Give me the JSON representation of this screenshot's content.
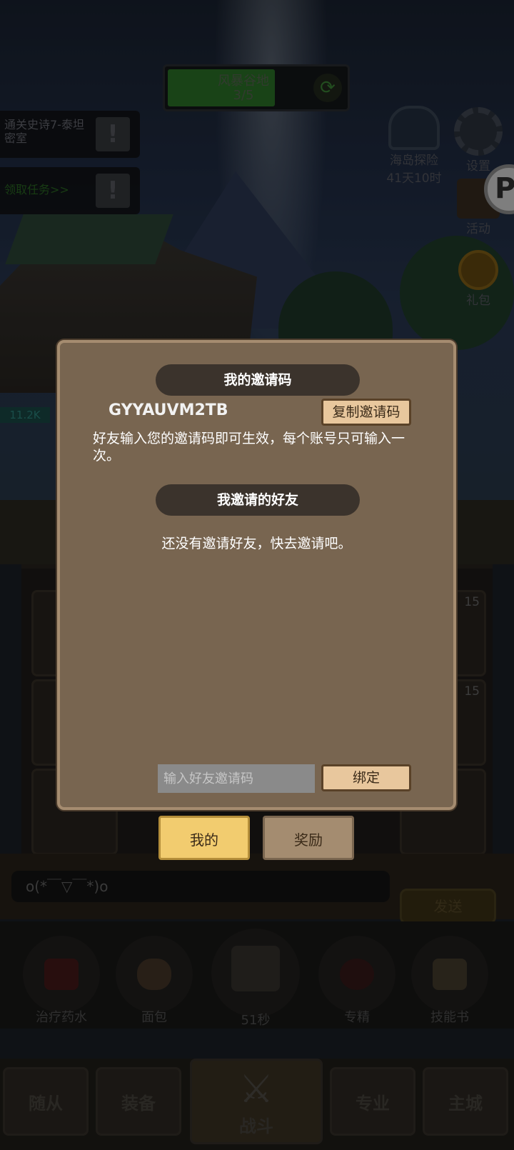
{
  "hud": {
    "storm": {
      "title": "风暴谷地",
      "progress_text": "3/5",
      "progress": 0.6
    },
    "quests": [
      {
        "text": "通关史诗7-泰坦密室"
      },
      {
        "text": "领取任务>>"
      }
    ],
    "island": {
      "label": "海岛探险",
      "timer": "41天10时"
    },
    "settings_label": "设置",
    "activity_label": "活动",
    "gift_label": "礼包"
  },
  "chat": {
    "input_value": "o(*￣▽￣*)o",
    "send_label": "发送"
  },
  "consumables": [
    {
      "label": "治疗药水"
    },
    {
      "label": "面包"
    },
    {
      "label": "51秒"
    },
    {
      "label": "专精"
    },
    {
      "label": "技能书"
    }
  ],
  "nav": {
    "followers": "随从",
    "equipment": "装备",
    "battle": "战斗",
    "profession": "专业",
    "city": "主城"
  },
  "dialog": {
    "my_code_title": "我的邀请码",
    "code": "GYYAUVM2TB",
    "copy_label": "复制邀请码",
    "hint": "好友输入您的邀请码即可生效，每个账号只可输入一次。",
    "friends_title": "我邀请的好友",
    "empty_text": "还没有邀请好友，快去邀请吧。",
    "bind_placeholder": "输入好友邀请码",
    "bind_label": "绑定"
  },
  "tabs": {
    "mine": "我的",
    "reward": "奖励"
  },
  "slot_levels": [
    "15",
    "15"
  ],
  "power": "11.2K"
}
